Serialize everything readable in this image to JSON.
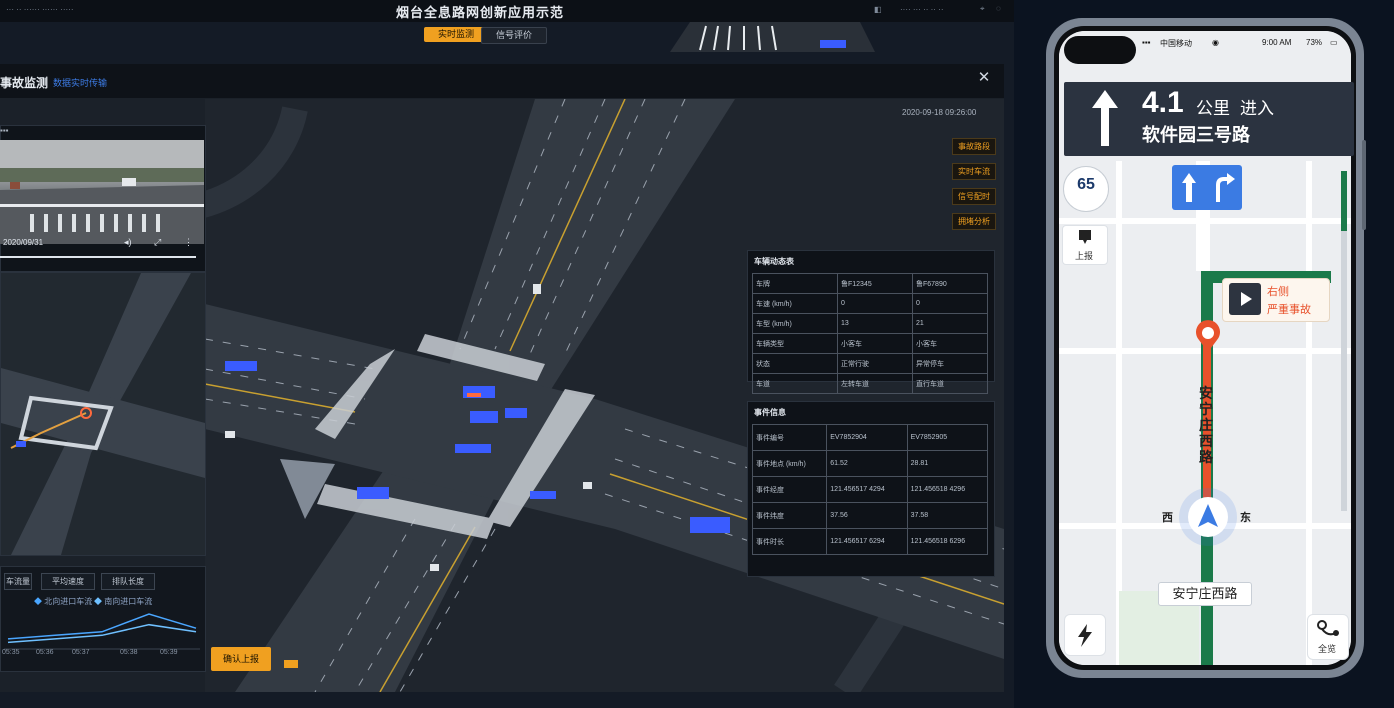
{
  "dashboard": {
    "app_title": "烟台全息路网创新应用示范",
    "tabs": [
      {
        "label": "实时监测",
        "active": true
      },
      {
        "label": "信号评价",
        "active": false
      }
    ],
    "panel": {
      "title": "事故监测",
      "subtitle": "数据实时传输",
      "close_icon": "close-icon",
      "timestamp": "2020-09-18 09:26:00",
      "video_time": "2020/09/31",
      "side_buttons": [
        "事故路段",
        "实时车流",
        "信号配时",
        "拥堵分析"
      ],
      "confirm_button": "确认上报"
    },
    "vehicle_table": {
      "title": "车辆动态表",
      "rows": [
        [
          "车牌",
          "鲁F12345",
          "鲁F67890"
        ],
        [
          "车速 (km/h)",
          "0",
          "0"
        ],
        [
          "车型 (km/h)",
          "13",
          "21"
        ],
        [
          "车辆类型",
          "小客车",
          "小客车"
        ],
        [
          "状态",
          "正常行驶",
          "异常停车"
        ],
        [
          "车道",
          "左转车道",
          "直行车道"
        ]
      ]
    },
    "event_table": {
      "title": "事件信息",
      "rows": [
        [
          "事件编号",
          "EV7852904",
          "EV7852905"
        ],
        [
          "事件地点 (km/h)",
          "61.52",
          "28.81"
        ],
        [
          "事件经度",
          "121.456517 4294",
          "121.456518 4296"
        ],
        [
          "事件纬度",
          "37.56",
          "37.58"
        ],
        [
          "事件时长",
          "121.456517 6294",
          "121.456518 6296"
        ]
      ]
    },
    "chart_tabs": [
      "车流量",
      "平均速度",
      "排队长度"
    ],
    "chart_legend": [
      "北向进口车流",
      "南向进口车流"
    ],
    "chart_data": {
      "type": "line",
      "x": [
        "05:35",
        "05:36",
        "05:37",
        "05:38",
        "05:39"
      ],
      "series": [
        {
          "name": "北向进口车流",
          "values": [
            2,
            3,
            4,
            9,
            5
          ]
        },
        {
          "name": "南向进口车流",
          "values": [
            1,
            2,
            3,
            6,
            4
          ]
        }
      ],
      "title": "",
      "xlabel": "",
      "ylabel": ""
    },
    "colors": {
      "accent": "#f0a020",
      "link": "#3d7ce6",
      "vehicle": "#3a5cff"
    }
  },
  "phone": {
    "status_bar": {
      "carrier": "中国移动",
      "time": "9:00 AM",
      "battery": "73%"
    },
    "nav": {
      "distance": "4.1",
      "unit": "公里",
      "action": "进入",
      "road": "软件园三号路"
    },
    "speed_limit": "65",
    "report_label": "上报",
    "alert": {
      "line1": "右侧",
      "line2": "严重事故"
    },
    "directions": {
      "west": "西",
      "east": "东"
    },
    "vertical_road": "安宁庄西路",
    "current_road": "安宁庄西路",
    "overview_label": "全览",
    "colors": {
      "route": "#1b7a4a",
      "alert": "#e8512b",
      "lane": "#3b7be3"
    }
  }
}
